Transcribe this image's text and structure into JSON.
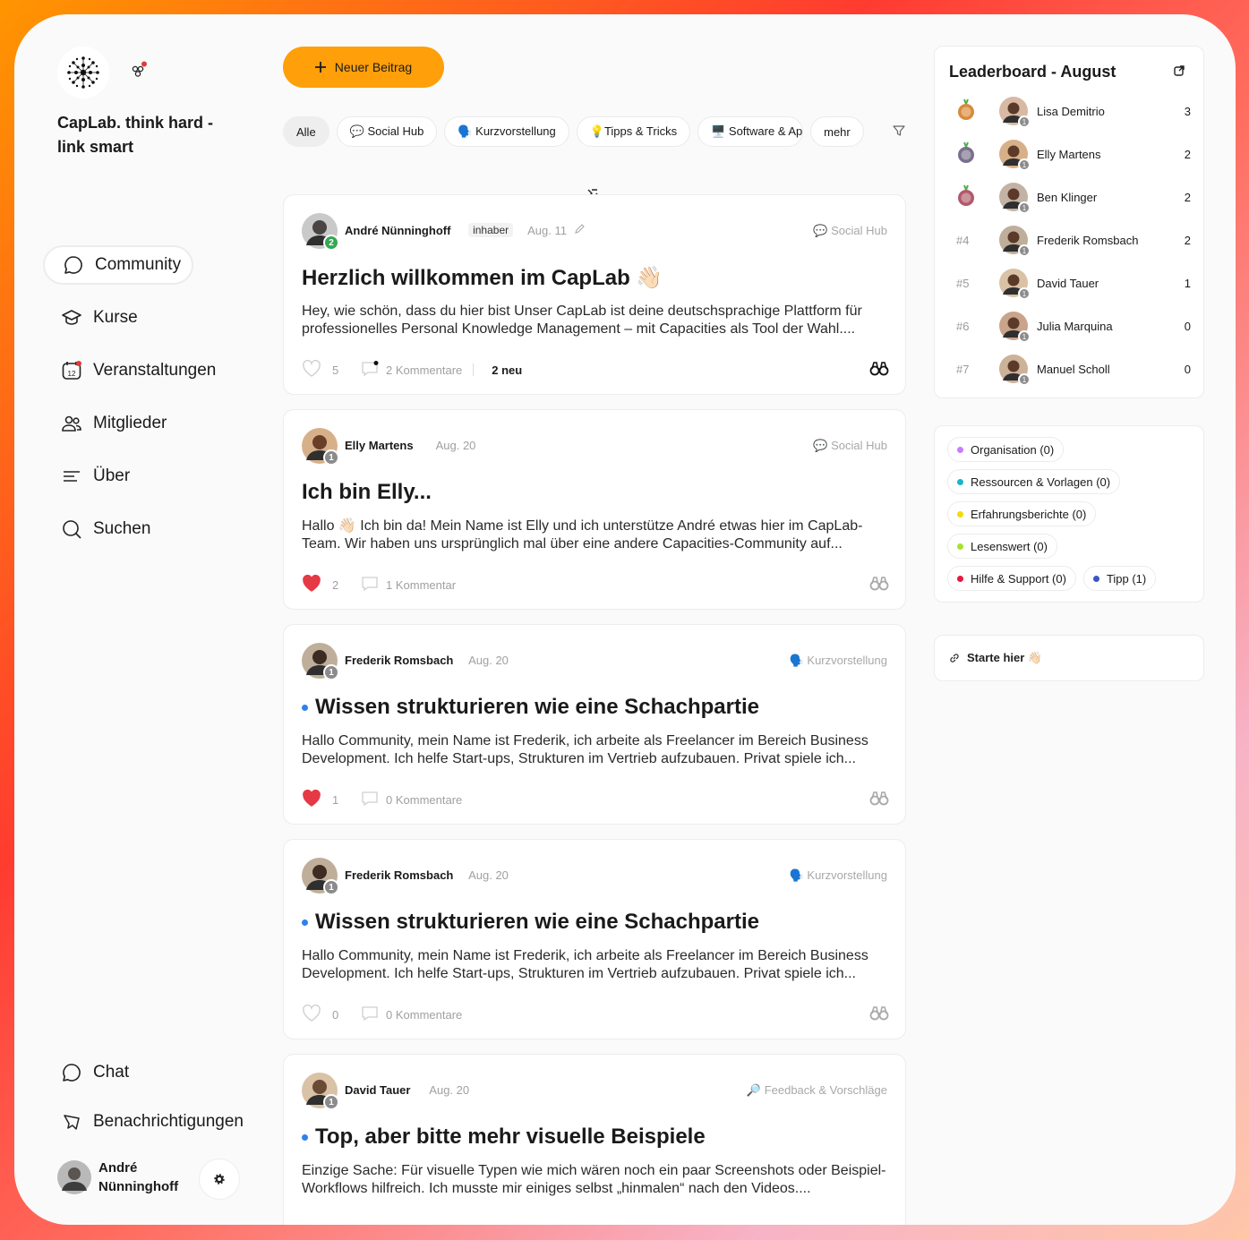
{
  "sidebar": {
    "brand": "CapLab. think hard - link smart",
    "nav": [
      {
        "label": "Community",
        "icon": "chat-bubble-icon"
      },
      {
        "label": "Kurse",
        "icon": "graduation-cap-icon"
      },
      {
        "label": "Veranstaltungen",
        "icon": "calendar-icon",
        "calendar_day": "12"
      },
      {
        "label": "Mitglieder",
        "icon": "members-icon"
      },
      {
        "label": "Über",
        "icon": "lines-icon"
      },
      {
        "label": "Suchen",
        "icon": "search-icon"
      }
    ],
    "bottom": [
      {
        "label": "Chat",
        "icon": "chat-icon"
      },
      {
        "label": "Benachrichtigungen",
        "icon": "notification-bubble-icon"
      }
    ],
    "user": {
      "name": "André Nünninghoff"
    }
  },
  "main": {
    "new_post_label": "Neuer Beitrag",
    "filters": [
      "Alle",
      "💬 Social Hub",
      "🗣️ Kurzvorstellung",
      "💡Tipps & Tricks",
      "🖥️ Software & Apps",
      "mehr"
    ],
    "posts": [
      {
        "author": "André Nünninghoff",
        "role": "inhaber",
        "date": "Aug. 11",
        "level": "2",
        "level_color": "#34a853",
        "space": "💬 Social Hub",
        "title": "Herzlich willkommen im CapLab 👋🏻",
        "unread": false,
        "excerpt": "Hey, wie schön, dass du hier bist Unser CapLab ist deine deutschsprachige Plattform für professionelles Personal Knowledge Management – mit Capacities als Tool der Wahl....",
        "likes": "5",
        "liked": false,
        "comments": "2 Kommentare",
        "new": "2 neu"
      },
      {
        "author": "Elly Martens",
        "date": "Aug. 20",
        "level": "1",
        "level_color": "#8b8b8b",
        "space": "💬 Social Hub",
        "title": "Ich bin Elly...",
        "unread": false,
        "excerpt": "Hallo 👋🏻 Ich bin da! Mein Name ist Elly und ich unterstütze André etwas hier im CapLab-Team. Wir haben uns ursprünglich mal über eine andere Capacities-Community auf...",
        "likes": "2",
        "liked": true,
        "comments": "1 Kommentar"
      },
      {
        "author": "Frederik Romsbach",
        "date": "Aug. 20",
        "level": "1",
        "level_color": "#8b8b8b",
        "space": "🗣️ Kurzvorstellung",
        "title": "Wissen strukturieren wie eine Schachpartie",
        "unread": true,
        "excerpt": "Hallo Community, mein Name ist Frederik, ich arbeite als Freelancer im Bereich Business Development. Ich helfe Start-ups, Strukturen im Vertrieb aufzubauen. Privat spiele ich...",
        "likes": "1",
        "liked": true,
        "comments": "0 Kommentare"
      },
      {
        "author": "Frederik Romsbach",
        "date": "Aug. 20",
        "level": "1",
        "level_color": "#8b8b8b",
        "space": "🗣️ Kurzvorstellung",
        "title": "Wissen strukturieren wie eine Schachpartie",
        "unread": true,
        "excerpt": "Hallo Community, mein Name ist Frederik, ich arbeite als Freelancer im Bereich Business Development. Ich helfe Start-ups, Strukturen im Vertrieb aufzubauen. Privat spiele ich...",
        "likes": "0",
        "liked": false,
        "comments": "0 Kommentare"
      },
      {
        "author": "David Tauer",
        "date": "Aug. 20",
        "level": "1",
        "level_color": "#8b8b8b",
        "space": "🔎 Feedback & Vorschläge",
        "title": "Top, aber bitte mehr visuelle Beispiele",
        "unread": true,
        "excerpt": "Einzige Sache: Für visuelle Typen wie mich wären noch ein paar Screenshots oder Beispiel-Workflows hilfreich. Ich musste mir einiges selbst „hinmalen“ nach den Videos....",
        "likes": "",
        "liked": false,
        "comments": ""
      }
    ]
  },
  "leaderboard": {
    "title": "Leaderboard - August",
    "rows": [
      {
        "rank": "",
        "medal": "gold",
        "name": "Lisa Demitrio",
        "points": "3"
      },
      {
        "rank": "",
        "medal": "silver",
        "name": "Elly Martens",
        "points": "2"
      },
      {
        "rank": "",
        "medal": "bronze",
        "name": "Ben Klinger",
        "points": "2"
      },
      {
        "rank": "#4",
        "medal": "",
        "name": "Frederik Romsbach",
        "points": "2"
      },
      {
        "rank": "#5",
        "medal": "",
        "name": "David Tauer",
        "points": "1"
      },
      {
        "rank": "#6",
        "medal": "",
        "name": "Julia Marquina",
        "points": "0"
      },
      {
        "rank": "#7",
        "medal": "",
        "name": "Manuel Scholl",
        "points": "0"
      }
    ],
    "level_badge": "1"
  },
  "tags": [
    {
      "label": "Organisation (0)",
      "color": "#c77dff"
    },
    {
      "label": "Ressourcen & Vorlagen (0)",
      "color": "#17b6c9"
    },
    {
      "label": "Erfahrungsberichte (0)",
      "color": "#f5d90a"
    },
    {
      "label": "Lesenswert (0)",
      "color": "#a6e22e"
    },
    {
      "label": "Hilfe & Support (0)",
      "color": "#e5193c"
    },
    {
      "label": "Tipp (1)",
      "color": "#3a55c8"
    }
  ],
  "start_link": "Starte hier 👋🏻"
}
